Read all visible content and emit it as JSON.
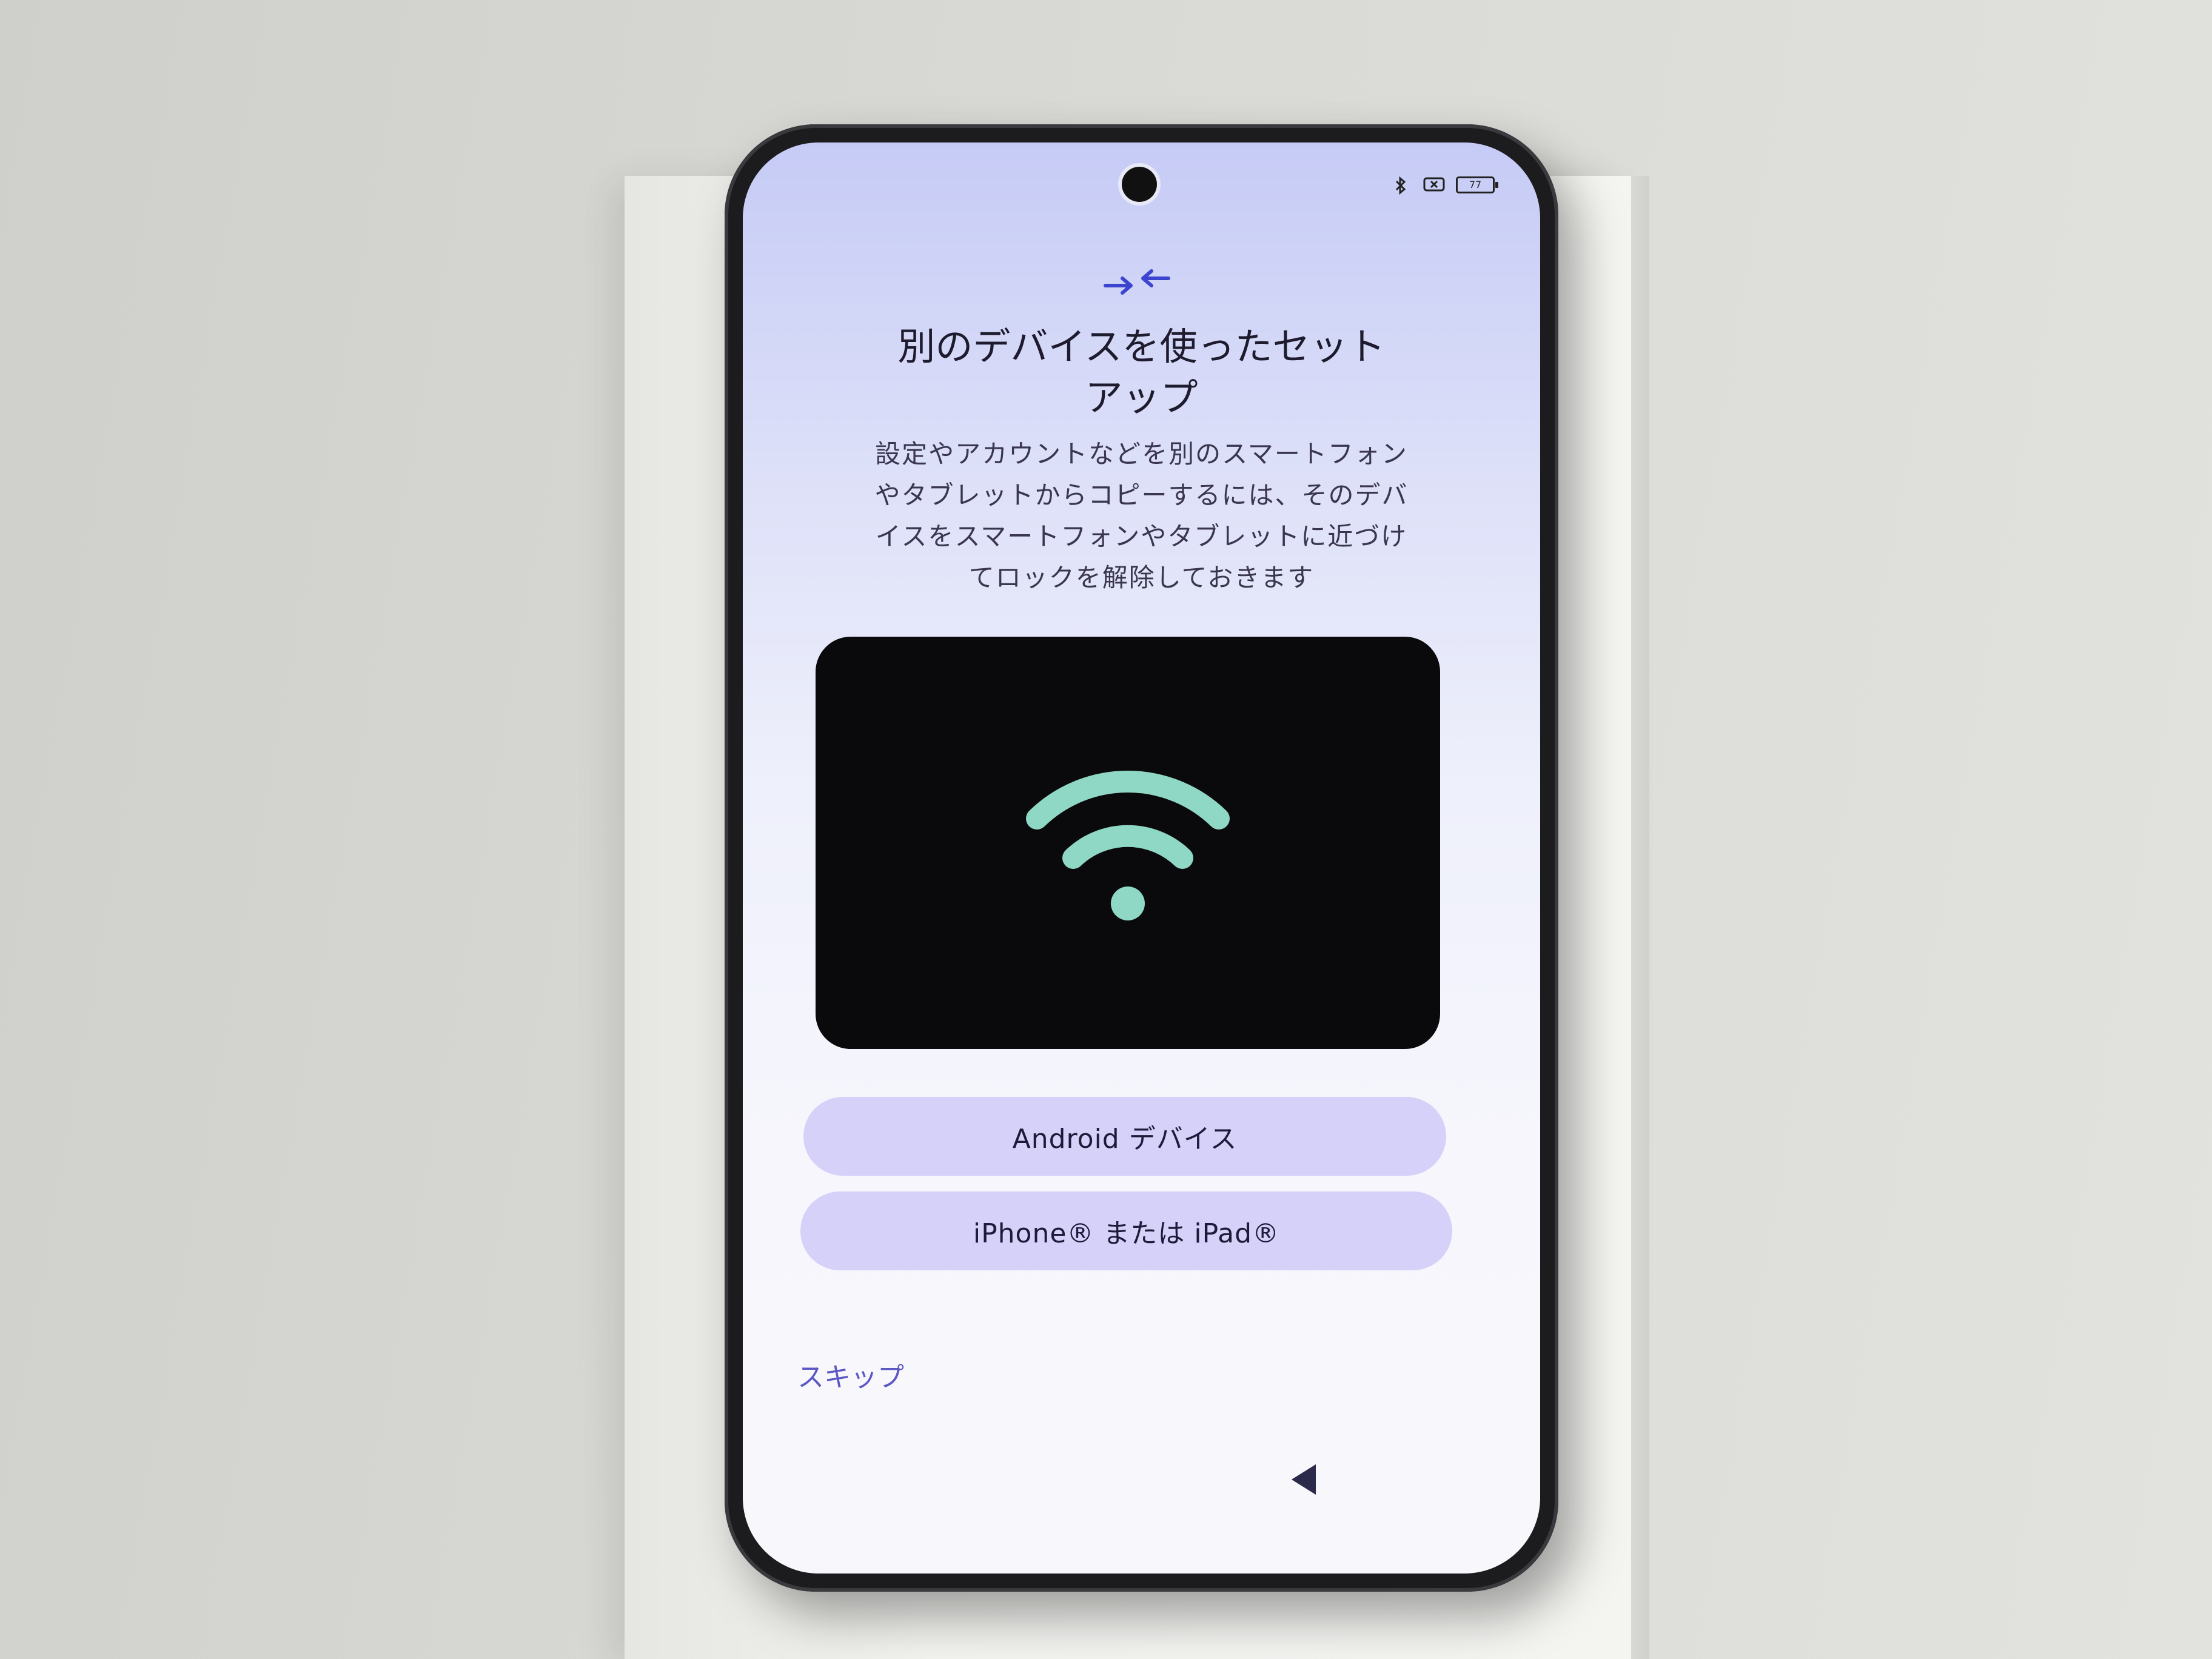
{
  "status_bar": {
    "bluetooth_icon": "bluetooth-icon",
    "sim_icon": "no-sim-icon",
    "battery_level": "77"
  },
  "header": {
    "icon": "connect-arrows-icon",
    "title_line1": "別のデバイスを使ったセット",
    "title_line2": "アップ"
  },
  "description": {
    "line1": "設定やアカウントなどを別のスマートフォン",
    "line2": "やタブレットからコピーするには、そのデバ",
    "line3": "イスをスマートフォンやタブレットに近づけ",
    "line4": "てロックを解除しておきます"
  },
  "illustration": {
    "icon": "wifi-icon",
    "accent": "#8fd8c6",
    "background": "#0a0a0c"
  },
  "buttons": {
    "android": "Android デバイス",
    "iphone": "iPhone® または iPad®"
  },
  "footer": {
    "skip": "スキップ"
  },
  "nav": {
    "back_icon": "back-triangle-icon"
  },
  "colors": {
    "button_bg": "#d5d1f8",
    "accent_text": "#5b57c4",
    "icon_blue": "#3b45d0"
  }
}
